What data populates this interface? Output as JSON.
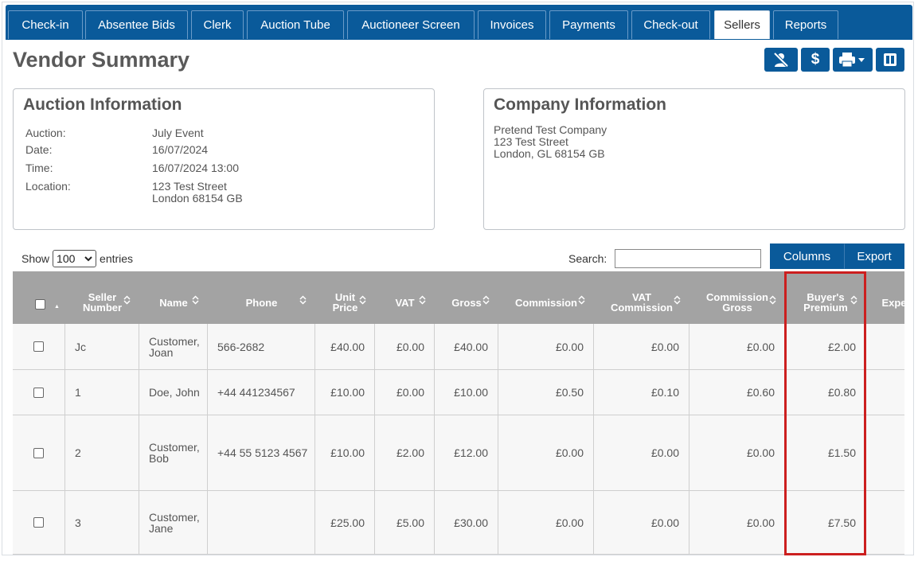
{
  "tabs": [
    {
      "label": "Check-in",
      "active": false
    },
    {
      "label": "Absentee Bids",
      "active": false
    },
    {
      "label": "Clerk",
      "active": false
    },
    {
      "label": "Auction Tube",
      "active": false
    },
    {
      "label": "Auctioneer Screen",
      "active": false
    },
    {
      "label": "Invoices",
      "active": false
    },
    {
      "label": "Payments",
      "active": false
    },
    {
      "label": "Check-out",
      "active": false
    },
    {
      "label": "Sellers",
      "active": true
    },
    {
      "label": "Reports",
      "active": false
    }
  ],
  "page_title": "Vendor Summary",
  "toolbar": {
    "icons": [
      "hide-user-icon",
      "dollar-icon",
      "print-dropdown-icon",
      "columns-icon"
    ]
  },
  "auction_info": {
    "title": "Auction Information",
    "rows": [
      {
        "label": "Auction:",
        "value": "July Event"
      },
      {
        "label": "Date:",
        "value": "16/07/2024"
      },
      {
        "label": "Time:",
        "value": "16/07/2024 13:00"
      },
      {
        "label": "Location:",
        "value": "123 Test Street",
        "value2": "London 68154 GB"
      }
    ]
  },
  "company_info": {
    "title": "Company Information",
    "lines": [
      "Pretend Test Company",
      "123 Test Street",
      "London, GL 68154 GB"
    ]
  },
  "table_controls": {
    "show_label": "Show",
    "entries_value": "100",
    "entries_label": "entries",
    "search_label": "Search:",
    "search_value": "",
    "columns_button": "Columns",
    "export_button": "Export"
  },
  "table": {
    "headers": [
      {
        "key": "select",
        "label": ""
      },
      {
        "key": "seller_number",
        "label": "Seller\nNumber"
      },
      {
        "key": "name",
        "label": "Name"
      },
      {
        "key": "phone",
        "label": "Phone"
      },
      {
        "key": "unit_price",
        "label": "Unit\nPrice"
      },
      {
        "key": "vat",
        "label": "VAT"
      },
      {
        "key": "gross",
        "label": "Gross"
      },
      {
        "key": "commission",
        "label": "Commission"
      },
      {
        "key": "vat_commission",
        "label": "VAT\nCommission"
      },
      {
        "key": "commission_gross",
        "label": "Commission\nGross"
      },
      {
        "key": "buyers_premium",
        "label": "Buyer's\nPremium"
      },
      {
        "key": "expenses",
        "label": "Expe"
      }
    ],
    "rows": [
      {
        "seller_number": "Jc",
        "name": "Customer,\nJoan",
        "phone": "566-2682",
        "unit_price": "£40.00",
        "vat": "£0.00",
        "gross": "£40.00",
        "commission": "£0.00",
        "vat_commission": "£0.00",
        "commission_gross": "£0.00",
        "buyers_premium": "£2.00",
        "expenses": "£"
      },
      {
        "seller_number": "1",
        "name": "Doe, John",
        "phone": "+44 441234567",
        "unit_price": "£10.00",
        "vat": "£0.00",
        "gross": "£10.00",
        "commission": "£0.50",
        "vat_commission": "£0.10",
        "commission_gross": "£0.60",
        "buyers_premium": "£0.80",
        "expenses": ""
      },
      {
        "seller_number": "2",
        "name": "Customer,\nBob",
        "phone": "+44 55 5123 4567",
        "unit_price": "£10.00",
        "vat": "£2.00",
        "gross": "£12.00",
        "commission": "£0.00",
        "vat_commission": "£0.00",
        "commission_gross": "£0.00",
        "buyers_premium": "£1.50",
        "expenses": ""
      },
      {
        "seller_number": "3",
        "name": "Customer,\nJane",
        "phone": "",
        "unit_price": "£25.00",
        "vat": "£5.00",
        "gross": "£30.00",
        "commission": "£0.00",
        "vat_commission": "£0.00",
        "commission_gross": "£0.00",
        "buyers_premium": "£7.50",
        "expenses": ""
      }
    ]
  },
  "colors": {
    "brand": "#0a5a9a",
    "table_header": "#a3a3a3",
    "highlight": "#cc1f1f"
  }
}
